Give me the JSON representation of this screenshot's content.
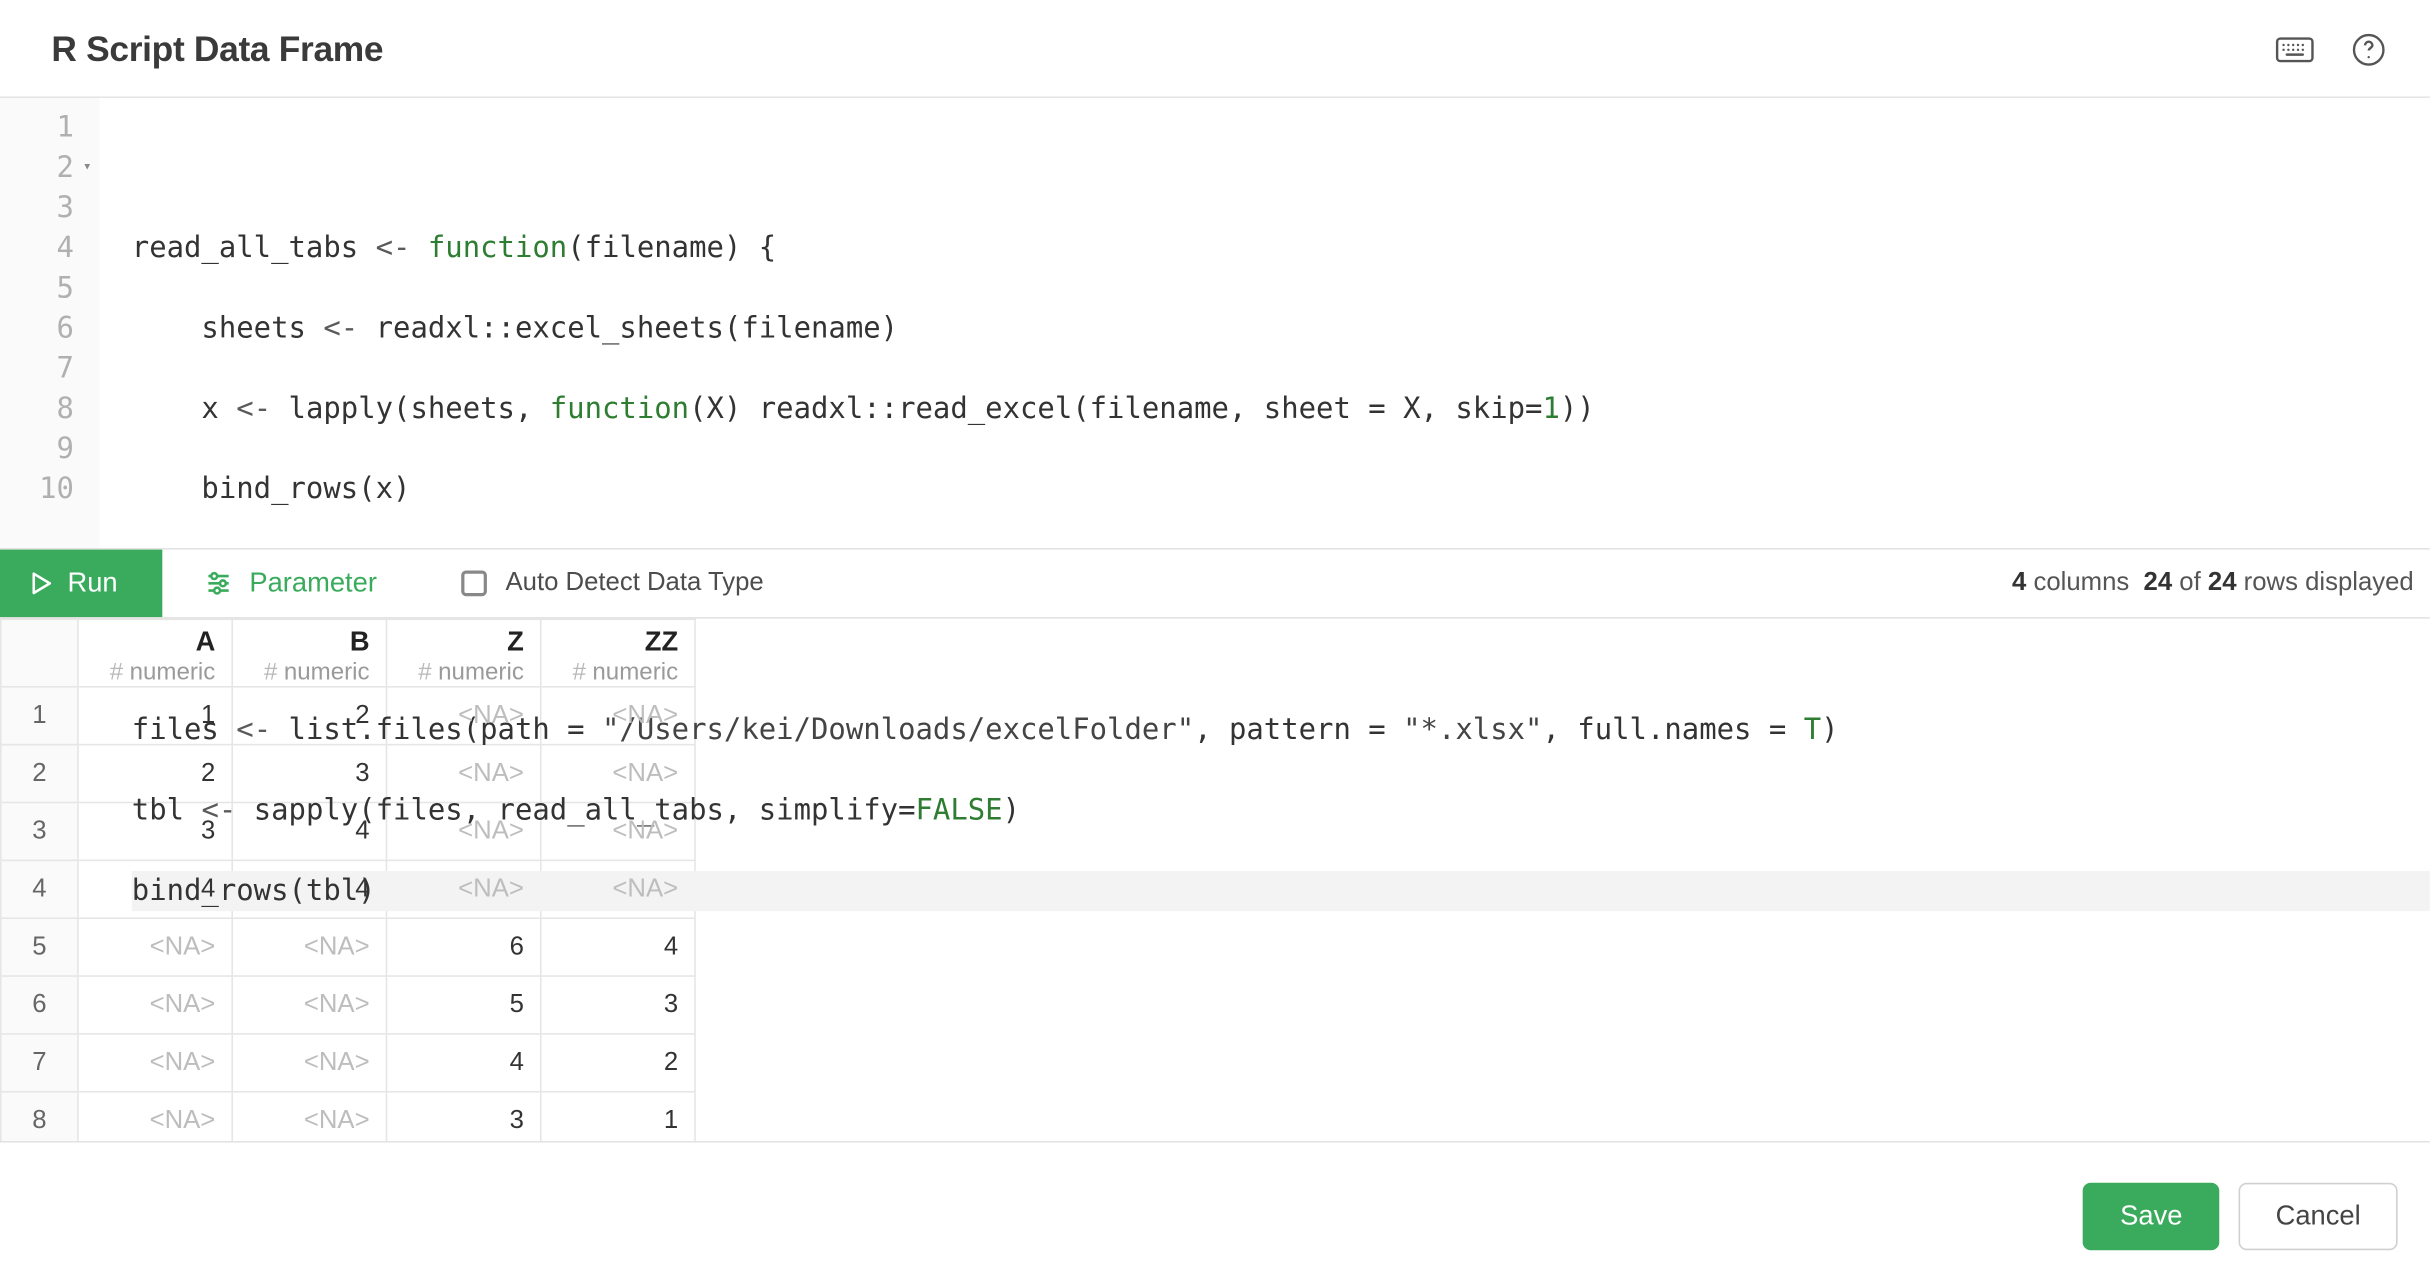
{
  "header": {
    "title": "R Script Data Frame"
  },
  "editor": {
    "line_count": 10,
    "fold_at": 2,
    "highlighted_line": 10,
    "lines": [
      "",
      "read_all_tabs <- function(filename) {",
      "    sheets <- readxl::excel_sheets(filename)",
      "    x <- lapply(sheets, function(X) readxl::read_excel(filename, sheet = X, skip=1))",
      "    bind_rows(x)",
      "}",
      "",
      "files <- list.files(path = \"/Users/kei/Downloads/excelFolder\", pattern = \"*.xlsx\", full.names = T)",
      "tbl <- sapply(files, read_all_tabs, simplify=FALSE)",
      "bind_rows(tbl)"
    ],
    "tokens": {
      "kw_function": "function",
      "kw_T": "T",
      "kw_FALSE": "FALSE",
      "num_1": "1",
      "str_path": "\"/Users/kei/Downloads/excelFolder\"",
      "str_pattern": "\"*.xlsx\""
    }
  },
  "toolbar": {
    "run_label": "Run",
    "parameter_label": "Parameter",
    "auto_detect_label": "Auto Detect Data Type",
    "auto_detect_checked": false,
    "status": {
      "columns_label": "columns",
      "columns": "4",
      "rows_shown": "24",
      "of_label": "of",
      "rows_total": "24",
      "rows_suffix": "rows displayed"
    }
  },
  "grid": {
    "columns": [
      {
        "name": "A",
        "type": "numeric"
      },
      {
        "name": "B",
        "type": "numeric"
      },
      {
        "name": "Z",
        "type": "numeric"
      },
      {
        "name": "ZZ",
        "type": "numeric"
      }
    ],
    "rows": [
      {
        "n": "1",
        "cells": [
          "1",
          "2",
          "<NA>",
          "<NA>"
        ]
      },
      {
        "n": "2",
        "cells": [
          "2",
          "3",
          "<NA>",
          "<NA>"
        ]
      },
      {
        "n": "3",
        "cells": [
          "3",
          "4",
          "<NA>",
          "<NA>"
        ]
      },
      {
        "n": "4",
        "cells": [
          "4",
          "4",
          "<NA>",
          "<NA>"
        ]
      },
      {
        "n": "5",
        "cells": [
          "<NA>",
          "<NA>",
          "6",
          "4"
        ]
      },
      {
        "n": "6",
        "cells": [
          "<NA>",
          "<NA>",
          "5",
          "3"
        ]
      },
      {
        "n": "7",
        "cells": [
          "<NA>",
          "<NA>",
          "4",
          "2"
        ]
      },
      {
        "n": "8",
        "cells": [
          "<NA>",
          "<NA>",
          "3",
          "1"
        ]
      }
    ],
    "na_token": "<NA>"
  },
  "footer": {
    "save_label": "Save",
    "cancel_label": "Cancel"
  }
}
